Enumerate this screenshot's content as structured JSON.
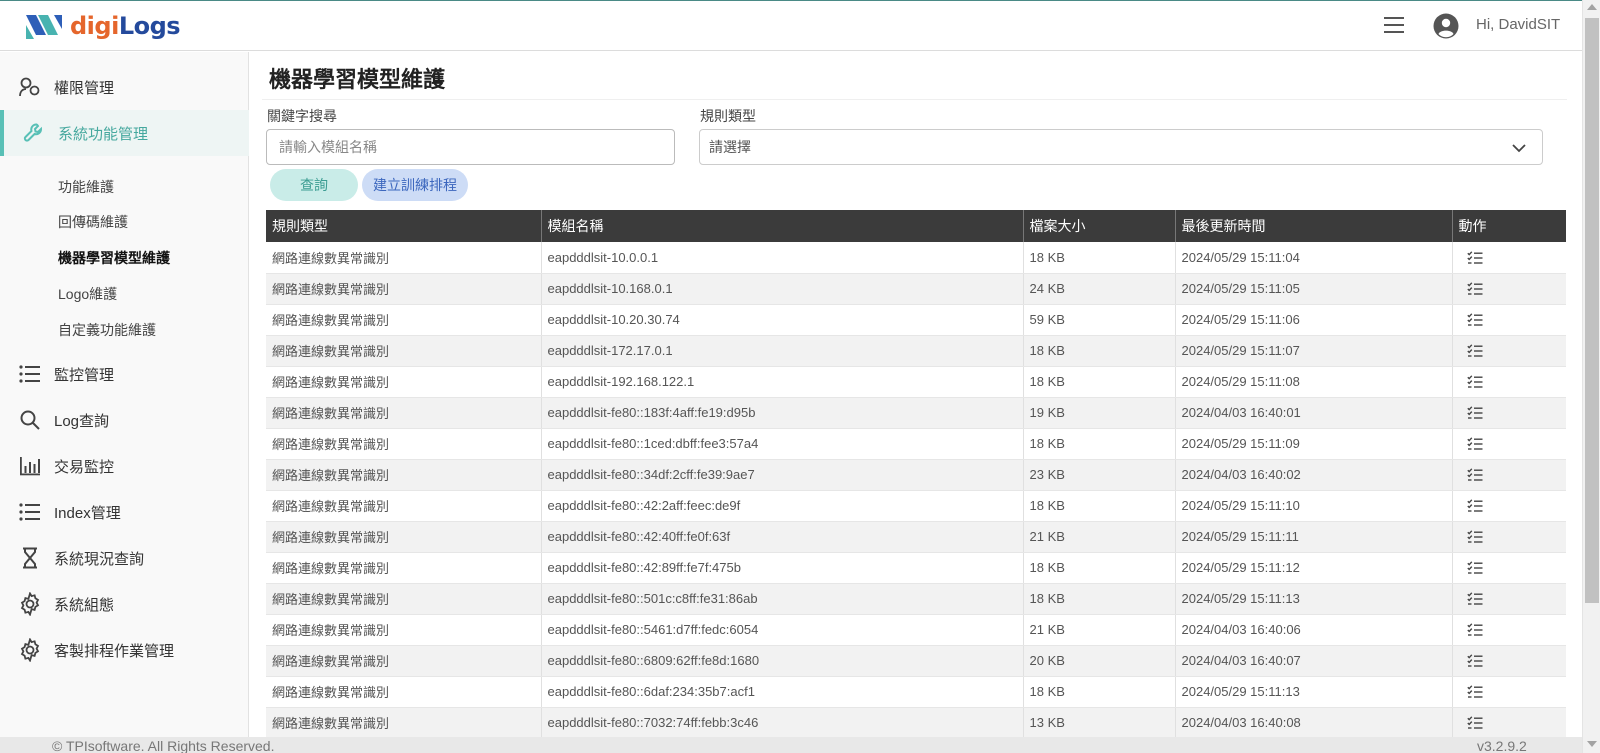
{
  "header": {
    "logo_brand_orange": "digi",
    "logo_brand_blue": "Logs",
    "greeting": "Hi, DavidSIT"
  },
  "sidebar": {
    "items": [
      {
        "label": "權限管理",
        "icon": "users-icon"
      },
      {
        "label": "系統功能管理",
        "icon": "wrench-icon",
        "active": true
      },
      {
        "label": "監控管理",
        "icon": "list-icon"
      },
      {
        "label": "Log查詢",
        "icon": "search-icon"
      },
      {
        "label": "交易監控",
        "icon": "bar-chart-icon"
      },
      {
        "label": "Index管理",
        "icon": "list-icon"
      },
      {
        "label": "系統現況查詢",
        "icon": "hourglass-icon"
      },
      {
        "label": "系統組態",
        "icon": "gear-icon"
      },
      {
        "label": "客製排程作業管理",
        "icon": "gear-icon"
      }
    ],
    "sub_items": [
      {
        "label": "功能維護"
      },
      {
        "label": "回傳碼維護"
      },
      {
        "label": "機器學習模型維護",
        "current": true
      },
      {
        "label": "Logo維護"
      },
      {
        "label": "自定義功能維護"
      }
    ]
  },
  "main": {
    "title": "機器學習模型維護",
    "keyword_label": "關鍵字搜尋",
    "keyword_placeholder": "請輸入模組名稱",
    "keyword_value": "",
    "rule_type_label": "規則類型",
    "rule_type_value": "請選擇",
    "query_button": "查詢",
    "train_button": "建立訓練排程"
  },
  "table": {
    "headers": [
      "規則類型",
      "模組名稱",
      "檔案大小",
      "最後更新時間",
      "動作"
    ],
    "rows": [
      [
        "網路連線數異常識別",
        "eapdddlsit-10.0.0.1",
        "18 KB",
        "2024/05/29 15:11:04"
      ],
      [
        "網路連線數異常識別",
        "eapdddlsit-10.168.0.1",
        "24 KB",
        "2024/05/29 15:11:05"
      ],
      [
        "網路連線數異常識別",
        "eapdddlsit-10.20.30.74",
        "59 KB",
        "2024/05/29 15:11:06"
      ],
      [
        "網路連線數異常識別",
        "eapdddlsit-172.17.0.1",
        "18 KB",
        "2024/05/29 15:11:07"
      ],
      [
        "網路連線數異常識別",
        "eapdddlsit-192.168.122.1",
        "18 KB",
        "2024/05/29 15:11:08"
      ],
      [
        "網路連線數異常識別",
        "eapdddlsit-fe80::183f:4aff:fe19:d95b",
        "19 KB",
        "2024/04/03 16:40:01"
      ],
      [
        "網路連線數異常識別",
        "eapdddlsit-fe80::1ced:dbff:fee3:57a4",
        "18 KB",
        "2024/05/29 15:11:09"
      ],
      [
        "網路連線數異常識別",
        "eapdddlsit-fe80::34df:2cff:fe39:9ae7",
        "23 KB",
        "2024/04/03 16:40:02"
      ],
      [
        "網路連線數異常識別",
        "eapdddlsit-fe80::42:2aff:feec:de9f",
        "18 KB",
        "2024/05/29 15:11:10"
      ],
      [
        "網路連線數異常識別",
        "eapdddlsit-fe80::42:40ff:fe0f:63f",
        "21 KB",
        "2024/05/29 15:11:11"
      ],
      [
        "網路連線數異常識別",
        "eapdddlsit-fe80::42:89ff:fe7f:475b",
        "18 KB",
        "2024/05/29 15:11:12"
      ],
      [
        "網路連線數異常識別",
        "eapdddlsit-fe80::501c:c8ff:fe31:86ab",
        "18 KB",
        "2024/05/29 15:11:13"
      ],
      [
        "網路連線數異常識別",
        "eapdddlsit-fe80::5461:d7ff:fedc:6054",
        "21 KB",
        "2024/04/03 16:40:06"
      ],
      [
        "網路連線數異常識別",
        "eapdddlsit-fe80::6809:62ff:fe8d:1680",
        "20 KB",
        "2024/04/03 16:40:07"
      ],
      [
        "網路連線數異常識別",
        "eapdddlsit-fe80::6daf:234:35b7:acf1",
        "18 KB",
        "2024/05/29 15:11:13"
      ],
      [
        "網路連線數異常識別",
        "eapdddlsit-fe80::7032:74ff:febb:3c46",
        "13 KB",
        "2024/04/03 16:40:08"
      ]
    ],
    "action_icon": "checklist-icon"
  },
  "footer": {
    "copyright": "© TPIsoftware. All Rights Reserved.",
    "version": "v3.2.9.2"
  },
  "colors": {
    "accent": "#58c0b6",
    "brand_orange": "#e5662c",
    "brand_blue": "#244a9c",
    "table_header": "#3b3b3b"
  }
}
